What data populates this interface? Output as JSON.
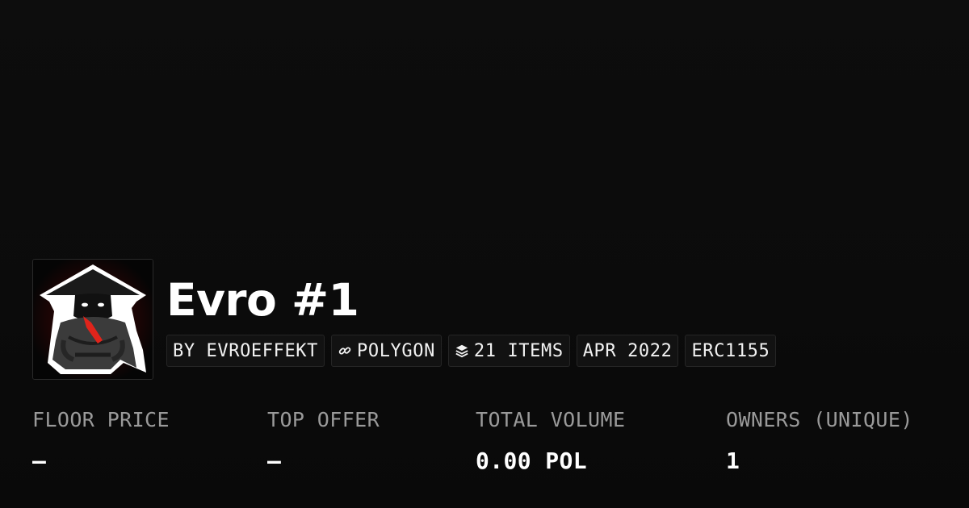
{
  "collection": {
    "title": "Evro #1",
    "avatar_icon": "ninja-logo-icon"
  },
  "badges": [
    {
      "label": "BY EVROEFFEKT",
      "icon": null
    },
    {
      "label": "POLYGON",
      "icon": "link-icon"
    },
    {
      "label": "21 ITEMS",
      "icon": "layers-icon"
    },
    {
      "label": "APR 2022",
      "icon": null
    },
    {
      "label": "ERC1155",
      "icon": null
    }
  ],
  "stats": {
    "floor_price": {
      "label": "FLOOR PRICE",
      "value": "–"
    },
    "top_offer": {
      "label": "TOP OFFER",
      "value": "–"
    },
    "total_volume": {
      "label": "TOTAL VOLUME",
      "value": "0.00 POL"
    },
    "owners": {
      "label": "OWNERS (UNIQUE)",
      "value": "1"
    }
  },
  "colors": {
    "background": "#0b0b0b",
    "text_primary": "#ffffff",
    "text_muted": "#9a9a9a",
    "badge_bg": "#121212",
    "badge_border": "#252525",
    "accent_red": "#e0241b"
  }
}
